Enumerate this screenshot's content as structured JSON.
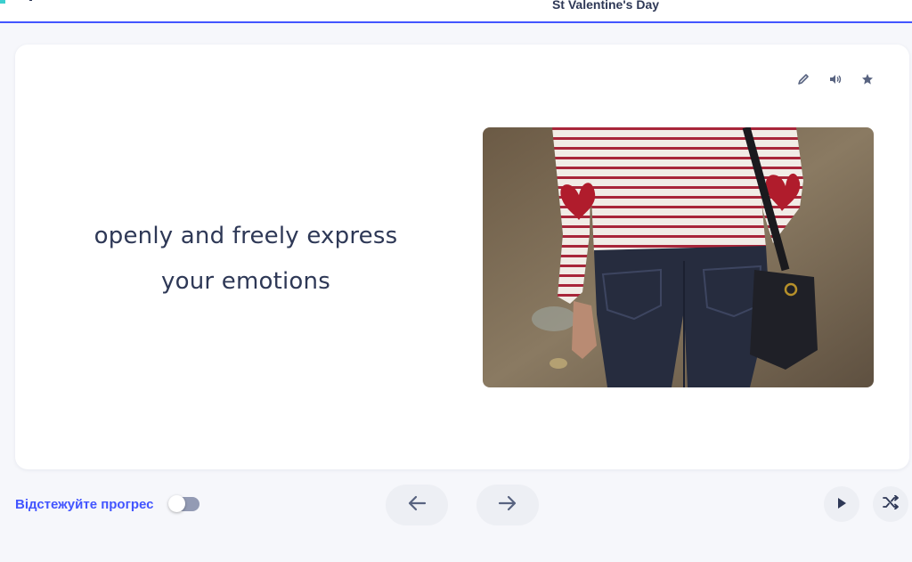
{
  "header": {
    "set_title": "St Valentine's Day"
  },
  "card": {
    "term_lines": [
      "openly and freely express",
      "your emotions"
    ],
    "tools": [
      "pencil-icon",
      "speaker-icon",
      "star-icon"
    ]
  },
  "footer": {
    "track_progress_label": "Відстежуйте прогрес",
    "toggle_on": false,
    "buttons": [
      "arrow-left-icon",
      "arrow-right-icon",
      "play-icon",
      "shuffle-icon"
    ]
  },
  "colors": {
    "accent": "#4255ff",
    "text": "#2e3856",
    "button_bg": "#edeff4"
  }
}
